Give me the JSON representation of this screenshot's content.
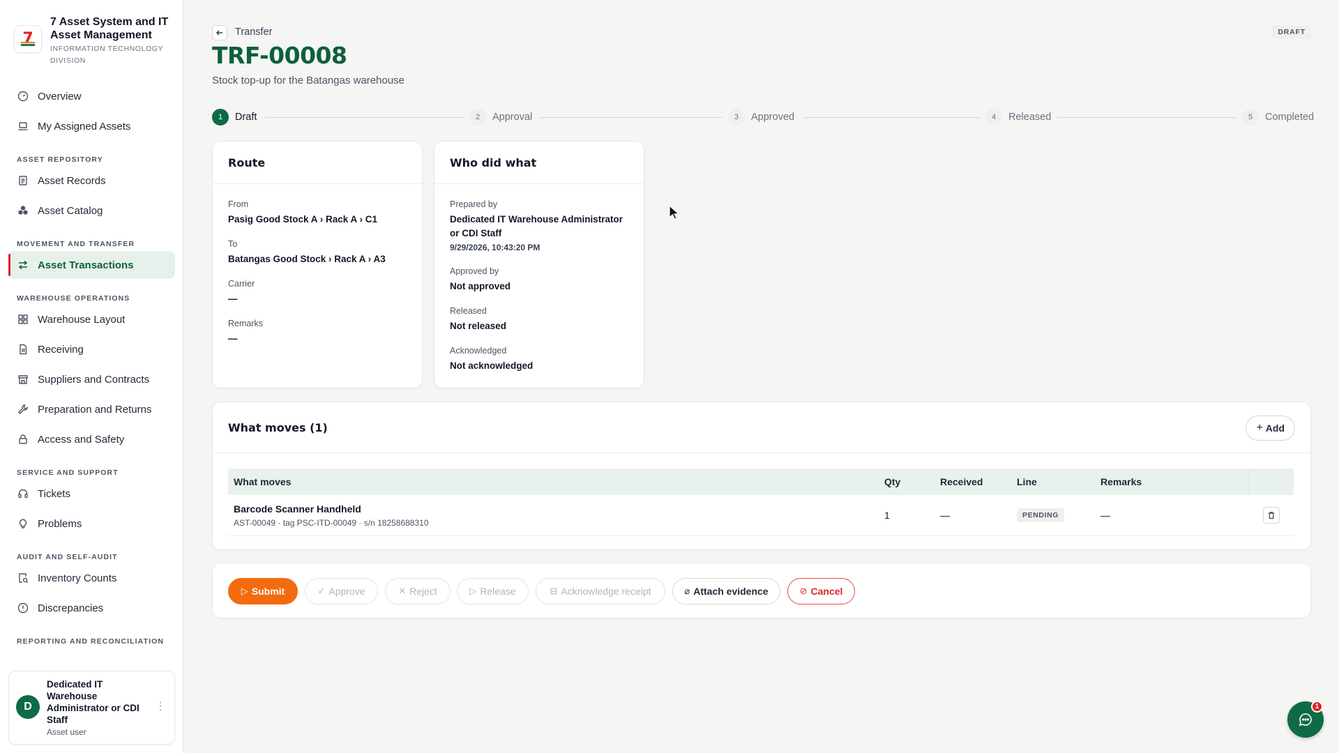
{
  "sidebar": {
    "brand_title": "7 Asset System and IT Asset Management",
    "brand_sub": "Information Technology Division",
    "overview": "Overview",
    "my_assets": "My Assigned Assets",
    "sec_repo": "Asset Repository",
    "asset_records": "Asset Records",
    "asset_catalog": "Asset Catalog",
    "sec_movement": "Movement and Transfer",
    "asset_transactions": "Asset Transactions",
    "sec_warehouse": "Warehouse Operations",
    "warehouse_layout": "Warehouse Layout",
    "receiving": "Receiving",
    "suppliers": "Suppliers and Contracts",
    "preparation": "Preparation and Returns",
    "access": "Access and Safety",
    "sec_service": "Service and Support",
    "tickets": "Tickets",
    "problems": "Problems",
    "sec_audit": "Audit and Self-Audit",
    "inventory_counts": "Inventory Counts",
    "discrepancies": "Discrepancies",
    "sec_reporting": "Reporting and Reconciliation",
    "user": {
      "initial": "D",
      "name": "Dedicated IT Warehouse Administrator or CDI Staff",
      "role": "Asset user"
    }
  },
  "header": {
    "crumb": "Transfer",
    "title": "TRF-00008",
    "subtitle": "Stock top-up for the Batangas warehouse",
    "status": "DRAFT"
  },
  "steps": [
    {
      "num": "1",
      "label": "Draft"
    },
    {
      "num": "2",
      "label": "Approval"
    },
    {
      "num": "3",
      "label": "Approved"
    },
    {
      "num": "4",
      "label": "Released"
    },
    {
      "num": "5",
      "label": "Completed"
    }
  ],
  "route": {
    "title": "Route",
    "from_label": "From",
    "from_value": "Pasig Good Stock A › Rack A › C1",
    "to_label": "To",
    "to_value": "Batangas Good Stock › Rack A › A3",
    "carrier_label": "Carrier",
    "carrier_value": "—",
    "remarks_label": "Remarks",
    "remarks_value": "—"
  },
  "who": {
    "title": "Who did what",
    "prepared_label": "Prepared by",
    "prepared_value": "Dedicated IT Warehouse Administrator or CDI Staff",
    "prepared_time": "9/29/2026, 10:43:20 PM",
    "approved_label": "Approved by",
    "approved_value": "Not approved",
    "released_label": "Released",
    "released_value": "Not released",
    "ack_label": "Acknowledged",
    "ack_value": "Not acknowledged"
  },
  "moves": {
    "title": "What moves (1)",
    "add_label": "Add",
    "columns": [
      "What moves",
      "Qty",
      "Received",
      "Line",
      "Remarks"
    ],
    "rows": [
      {
        "name": "Barcode Scanner Handheld",
        "meta": "AST-00049 · tag PSC-ITD-00049 · s/n 18258688310",
        "qty": "1",
        "received": "—",
        "line": "PENDING",
        "remarks": "—"
      }
    ]
  },
  "actions": {
    "submit": "Submit",
    "approve": "Approve",
    "reject": "Reject",
    "release": "Release",
    "acknowledge": "Acknowledge receipt",
    "attach": "Attach evidence",
    "cancel": "Cancel"
  },
  "chat": {
    "badge": "1"
  },
  "colors": {
    "brand_green": "#0f6b45",
    "accent_orange": "#f26b0f",
    "danger": "#dc2626"
  }
}
